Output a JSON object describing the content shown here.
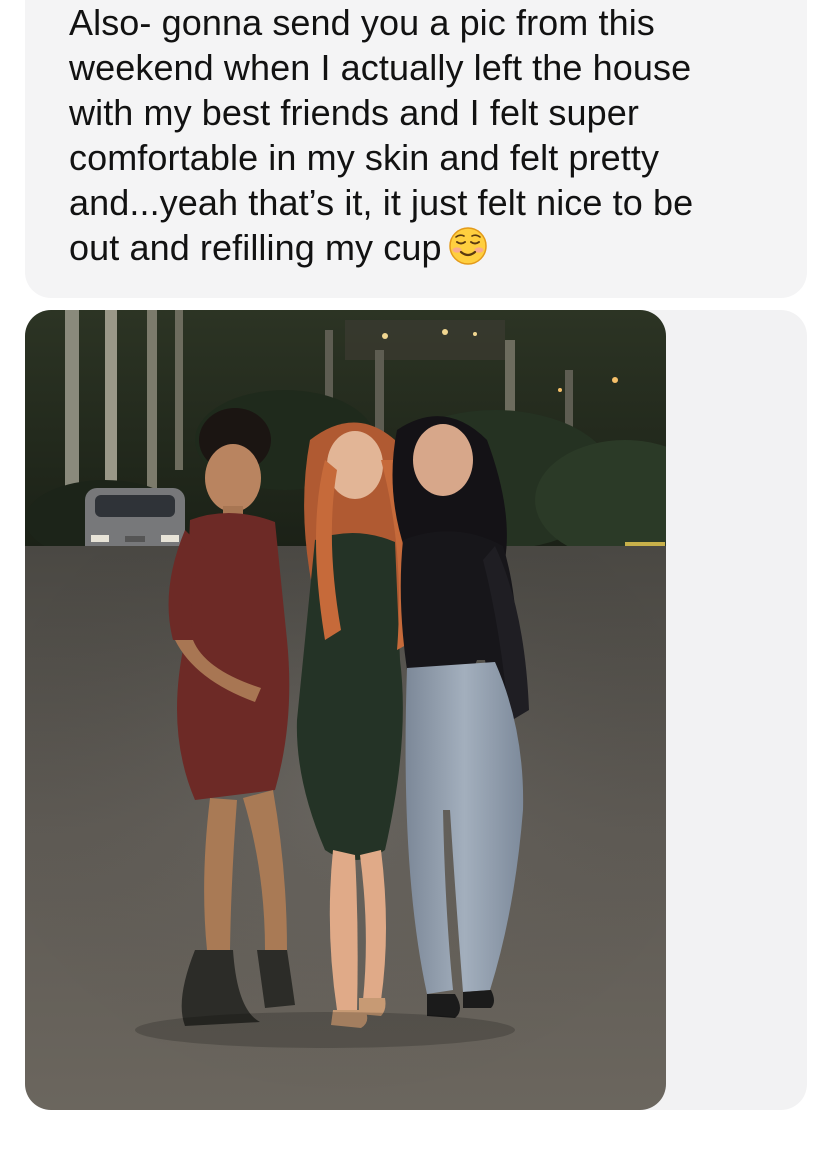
{
  "message": {
    "lines": [
      "Also- gonna send you a pic from this",
      "weekend when I actually left the house",
      "with my best friends and I felt super",
      "comfortable in my skin and felt pretty",
      "and...yeah that’s it, it just felt nice to be",
      "out and refilling my cup"
    ],
    "emoji": "smiling-face-icon"
  },
  "photo": {
    "icon": "photo-attachment",
    "colors": {
      "sky": "#1a2016",
      "trees": "#253222",
      "asphalt": "#5a5651",
      "dress_left": "#6d2a26",
      "dress_middle": "#243326",
      "top_right": "#17161a",
      "jeans": "#8e9bab",
      "hair_red": "#b05a32"
    }
  }
}
